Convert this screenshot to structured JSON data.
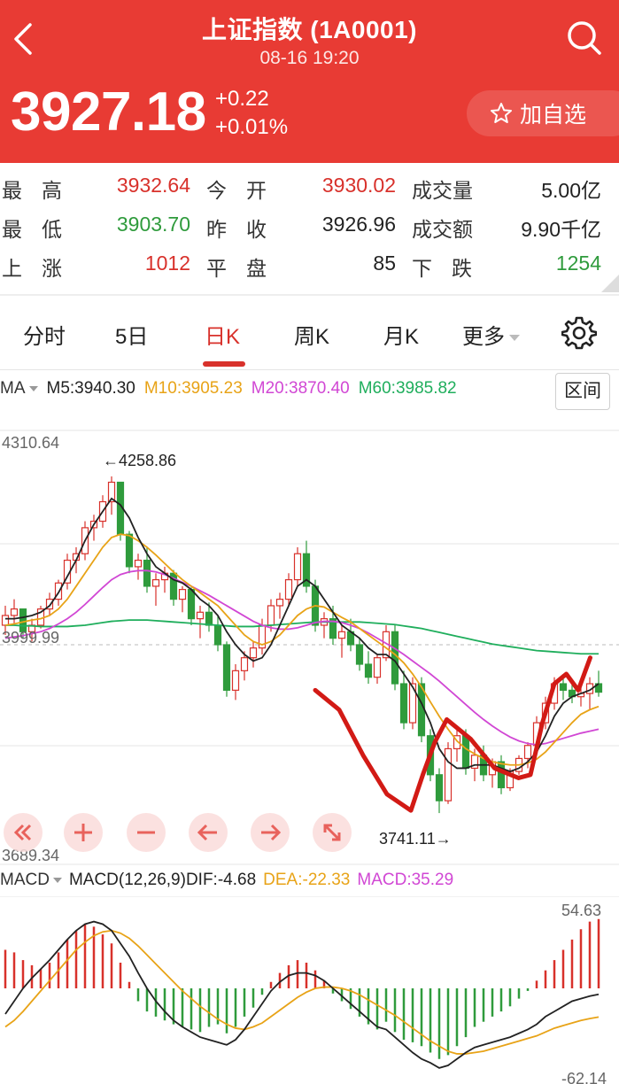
{
  "header": {
    "title": "上证指数 (1A0001)",
    "time": "08-16  19:20",
    "price": "3927.18",
    "change": "+0.22",
    "change_pct": "+0.01%",
    "fav_label": "加自选",
    "bg_color": "#e83b34"
  },
  "stats": {
    "high_label": "最高",
    "high": "3932.64",
    "open_label": "今开",
    "open": "3930.02",
    "volume_label": "成交量",
    "volume": "5.00亿",
    "low_label": "最低",
    "low": "3903.70",
    "prev_close_label": "昨收",
    "prev_close": "3926.96",
    "amount_label": "成交额",
    "amount": "9.90千亿",
    "up_label": "上涨",
    "up": "1012",
    "flat_label": "平盘",
    "flat": "85",
    "down_label": "下跌",
    "down": "1254"
  },
  "tabs": [
    {
      "label": "分时"
    },
    {
      "label": "5日"
    },
    {
      "label": "日K",
      "active": true
    },
    {
      "label": "周K"
    },
    {
      "label": "月K"
    },
    {
      "label": "更多"
    }
  ],
  "ma_legend": {
    "selector": "MA",
    "ma5": "M5:3940.30",
    "ma10": "M10:3905.23",
    "ma20": "M20:3870.40",
    "ma60": "M60:3985.82",
    "range_label": "区间",
    "colors": {
      "ma5": "#222222",
      "ma10": "#e8a317",
      "ma20": "#d147d4",
      "ma60": "#1fae5c"
    }
  },
  "price_chart": {
    "y_max_label": "4310.64",
    "y_mid_label": "3999.99",
    "y_min_label": "3689.34",
    "high_marker": "←4258.86",
    "low_marker": "3741.11→"
  },
  "macd_legend": {
    "selector": "MACD",
    "params": "MACD(12,26,9)",
    "dif": "DIF:-4.68",
    "dea": "DEA:-22.33",
    "macd": "MACD:35.29",
    "top_label": "54.63",
    "bottom_label": "-62.14",
    "colors": {
      "dif": "#222222",
      "dea": "#e8a317",
      "macd": "#d147d4",
      "up": "#d8312b",
      "down": "#2f9b3c"
    }
  },
  "chart_data": {
    "type": "candlestick",
    "x_range": [
      0,
      70
    ],
    "y_range": [
      3689.34,
      4310.64
    ],
    "ohlc": [
      [
        4030,
        4060,
        4015,
        4045
      ],
      [
        4045,
        4070,
        4030,
        4055
      ],
      [
        4055,
        4050,
        4010,
        4020
      ],
      [
        4020,
        4040,
        4005,
        4030
      ],
      [
        4030,
        4060,
        4025,
        4055
      ],
      [
        4055,
        4080,
        4045,
        4070
      ],
      [
        4070,
        4100,
        4060,
        4095
      ],
      [
        4095,
        4140,
        4085,
        4130
      ],
      [
        4130,
        4150,
        4110,
        4140
      ],
      [
        4140,
        4190,
        4130,
        4180
      ],
      [
        4180,
        4200,
        4160,
        4190
      ],
      [
        4190,
        4230,
        4180,
        4220
      ],
      [
        4220,
        4259,
        4200,
        4250
      ],
      [
        4250,
        4230,
        4160,
        4170
      ],
      [
        4170,
        4175,
        4110,
        4120
      ],
      [
        4120,
        4140,
        4100,
        4130
      ],
      [
        4130,
        4150,
        4080,
        4090
      ],
      [
        4090,
        4110,
        4060,
        4100
      ],
      [
        4100,
        4120,
        4080,
        4110
      ],
      [
        4110,
        4115,
        4060,
        4070
      ],
      [
        4070,
        4090,
        4050,
        4085
      ],
      [
        4085,
        4088,
        4030,
        4040
      ],
      [
        4040,
        4060,
        4010,
        4050
      ],
      [
        4050,
        4065,
        4020,
        4030
      ],
      [
        4030,
        4045,
        3990,
        4000
      ],
      [
        4000,
        4005,
        3920,
        3930
      ],
      [
        3930,
        3970,
        3915,
        3960
      ],
      [
        3960,
        3990,
        3945,
        3980
      ],
      [
        3980,
        4005,
        3965,
        3995
      ],
      [
        3995,
        4040,
        3985,
        4030
      ],
      [
        4030,
        4070,
        4020,
        4060
      ],
      [
        4060,
        4080,
        4040,
        4070
      ],
      [
        4070,
        4110,
        4060,
        4100
      ],
      [
        4100,
        4150,
        4090,
        4140
      ],
      [
        4140,
        4160,
        4080,
        4090
      ],
      [
        4090,
        4100,
        4020,
        4030
      ],
      [
        4030,
        4050,
        4010,
        4040
      ],
      [
        4040,
        4060,
        4000,
        4010
      ],
      [
        4010,
        4030,
        3980,
        4020
      ],
      [
        4020,
        4040,
        3990,
        4000
      ],
      [
        4000,
        4010,
        3960,
        3970
      ],
      [
        3970,
        3990,
        3940,
        3950
      ],
      [
        3950,
        3985,
        3940,
        3980
      ],
      [
        3980,
        4030,
        3975,
        4020
      ],
      [
        4020,
        4030,
        3930,
        3940
      ],
      [
        3940,
        3960,
        3870,
        3880
      ],
      [
        3880,
        3950,
        3870,
        3940
      ],
      [
        3940,
        3950,
        3850,
        3860
      ],
      [
        3860,
        3870,
        3790,
        3800
      ],
      [
        3800,
        3810,
        3741,
        3760
      ],
      [
        3760,
        3850,
        3755,
        3840
      ],
      [
        3840,
        3870,
        3820,
        3860
      ],
      [
        3860,
        3870,
        3800,
        3810
      ],
      [
        3810,
        3840,
        3790,
        3830
      ],
      [
        3830,
        3845,
        3790,
        3800
      ],
      [
        3800,
        3825,
        3780,
        3820
      ],
      [
        3820,
        3830,
        3770,
        3780
      ],
      [
        3780,
        3810,
        3775,
        3805
      ],
      [
        3805,
        3830,
        3800,
        3825
      ],
      [
        3825,
        3850,
        3810,
        3845
      ],
      [
        3845,
        3890,
        3840,
        3880
      ],
      [
        3880,
        3920,
        3870,
        3910
      ],
      [
        3910,
        3950,
        3900,
        3940
      ],
      [
        3940,
        3955,
        3915,
        3930
      ],
      [
        3930,
        3945,
        3910,
        3920
      ],
      [
        3920,
        3935,
        3905,
        3925
      ],
      [
        3925,
        3950,
        3900,
        3940
      ],
      [
        3940,
        3960,
        3920,
        3927
      ]
    ],
    "ma5": [
      4040,
      4040,
      4042,
      4045,
      4050,
      4060,
      4080,
      4105,
      4130,
      4160,
      4185,
      4205,
      4225,
      4215,
      4195,
      4165,
      4140,
      4120,
      4110,
      4100,
      4095,
      4085,
      4070,
      4060,
      4045,
      4020,
      4000,
      3985,
      3975,
      3980,
      4000,
      4030,
      4060,
      4090,
      4100,
      4090,
      4070,
      4050,
      4030,
      4020,
      4010,
      3995,
      3985,
      3985,
      3975,
      3955,
      3935,
      3910,
      3880,
      3840,
      3820,
      3810,
      3810,
      3815,
      3815,
      3815,
      3810,
      3805,
      3810,
      3820,
      3835,
      3860,
      3890,
      3910,
      3920,
      3925,
      3930,
      3940
    ],
    "ma10": [
      4030,
      4032,
      4035,
      4038,
      4040,
      4045,
      4055,
      4070,
      4090,
      4110,
      4130,
      4150,
      4165,
      4170,
      4168,
      4160,
      4150,
      4138,
      4125,
      4112,
      4100,
      4090,
      4080,
      4070,
      4060,
      4045,
      4030,
      4015,
      4005,
      4000,
      4005,
      4015,
      4030,
      4045,
      4055,
      4060,
      4058,
      4050,
      4042,
      4035,
      4025,
      4015,
      4005,
      3995,
      3985,
      3972,
      3955,
      3935,
      3912,
      3890,
      3870,
      3852,
      3840,
      3832,
      3825,
      3820,
      3817,
      3815,
      3815,
      3818,
      3824,
      3835,
      3850,
      3865,
      3880,
      3893,
      3900,
      3905
    ],
    "ma20": [
      4010,
      4012,
      4014,
      4017,
      4020,
      4025,
      4032,
      4040,
      4050,
      4062,
      4075,
      4088,
      4100,
      4108,
      4112,
      4114,
      4114,
      4112,
      4108,
      4102,
      4096,
      4090,
      4083,
      4076,
      4068,
      4060,
      4052,
      4044,
      4036,
      4030,
      4026,
      4024,
      4024,
      4026,
      4030,
      4034,
      4036,
      4036,
      4034,
      4030,
      4025,
      4018,
      4010,
      4002,
      3994,
      3985,
      3975,
      3965,
      3955,
      3944,
      3932,
      3920,
      3908,
      3896,
      3885,
      3875,
      3866,
      3858,
      3852,
      3848,
      3846,
      3848,
      3852,
      3856,
      3860,
      3864,
      3867,
      3870
    ],
    "ma60": [
      4030,
      4030,
      4029,
      4029,
      4028,
      4028,
      4028,
      4028,
      4029,
      4030,
      4032,
      4034,
      4036,
      4037,
      4038,
      4038,
      4038,
      4037,
      4036,
      4035,
      4034,
      4033,
      4032,
      4031,
      4030,
      4029,
      4028,
      4028,
      4028,
      4029,
      4030,
      4031,
      4032,
      4033,
      4034,
      4035,
      4035,
      4035,
      4035,
      4035,
      4035,
      4034,
      4033,
      4032,
      4031,
      4029,
      4027,
      4025,
      4022,
      4019,
      4016,
      4013,
      4010,
      4007,
      4004,
      4001,
      3999,
      3997,
      3995,
      3993,
      3991,
      3990,
      3989,
      3988,
      3987,
      3986,
      3986,
      3986
    ],
    "macd_hist": [
      30,
      28,
      22,
      18,
      15,
      20,
      28,
      38,
      45,
      50,
      48,
      42,
      35,
      20,
      5,
      -10,
      -18,
      -22,
      -25,
      -28,
      -30,
      -32,
      -34,
      -30,
      -28,
      -35,
      -30,
      -22,
      -15,
      -5,
      5,
      12,
      18,
      22,
      20,
      14,
      6,
      -4,
      -10,
      -16,
      -22,
      -28,
      -32,
      -26,
      -34,
      -40,
      -42,
      -45,
      -50,
      -55,
      -52,
      -45,
      -38,
      -30,
      -26,
      -22,
      -18,
      -14,
      -8,
      -2,
      6,
      14,
      22,
      30,
      38,
      46,
      52,
      54
    ],
    "dif": [
      -20,
      -10,
      0,
      8,
      15,
      22,
      30,
      38,
      45,
      50,
      52,
      50,
      45,
      35,
      25,
      12,
      0,
      -10,
      -18,
      -25,
      -30,
      -34,
      -38,
      -40,
      -42,
      -44,
      -40,
      -32,
      -22,
      -12,
      -2,
      5,
      10,
      12,
      12,
      10,
      6,
      0,
      -6,
      -12,
      -18,
      -24,
      -30,
      -32,
      -38,
      -44,
      -50,
      -55,
      -58,
      -62,
      -60,
      -55,
      -50,
      -46,
      -44,
      -42,
      -40,
      -38,
      -35,
      -32,
      -28,
      -22,
      -18,
      -14,
      -10,
      -8,
      -6,
      -4.68
    ],
    "dea": [
      -30,
      -25,
      -18,
      -10,
      -2,
      6,
      14,
      22,
      30,
      36,
      41,
      44,
      45,
      43,
      39,
      33,
      26,
      19,
      12,
      5,
      -2,
      -8,
      -14,
      -19,
      -24,
      -28,
      -31,
      -32,
      -30,
      -27,
      -22,
      -17,
      -12,
      -7,
      -3,
      0,
      1,
      1,
      0,
      -2,
      -5,
      -9,
      -13,
      -17,
      -21,
      -26,
      -31,
      -36,
      -41,
      -45,
      -49,
      -51,
      -51,
      -50,
      -49,
      -47,
      -45,
      -43,
      -41,
      -39,
      -37,
      -34,
      -31,
      -29,
      -27,
      -25,
      -23.5,
      -22.33
    ],
    "hand_drawn_line_color": "#d21a15"
  }
}
